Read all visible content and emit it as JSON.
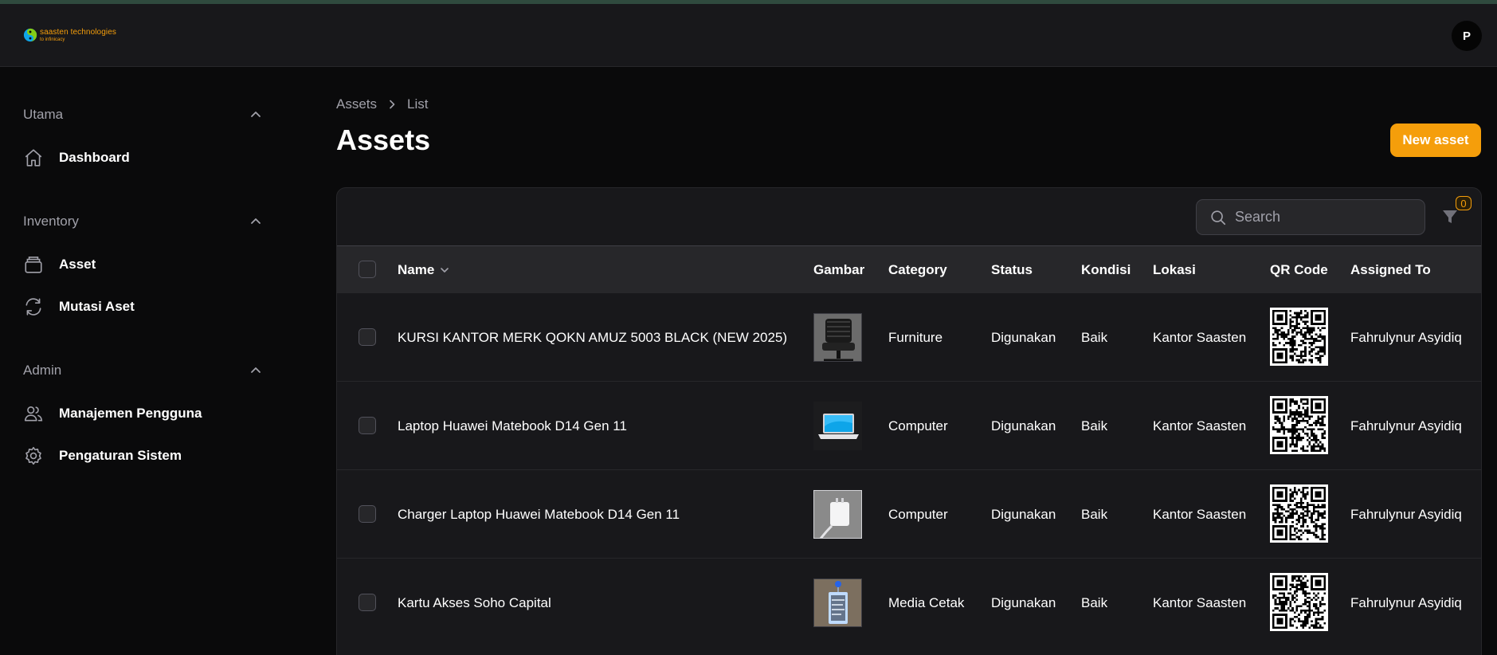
{
  "brand": {
    "line1": "saasten technologies",
    "line2": "to infinicacy"
  },
  "user": {
    "avatar_initial": "P"
  },
  "sidebar": {
    "groups": [
      {
        "label": "Utama",
        "items": [
          {
            "label": "Dashboard",
            "icon": "home-icon"
          }
        ]
      },
      {
        "label": "Inventory",
        "items": [
          {
            "label": "Asset",
            "icon": "box-icon"
          },
          {
            "label": "Mutasi Aset",
            "icon": "refresh-icon"
          }
        ]
      },
      {
        "label": "Admin",
        "items": [
          {
            "label": "Manajemen Pengguna",
            "icon": "users-icon"
          },
          {
            "label": "Pengaturan Sistem",
            "icon": "gear-icon"
          }
        ]
      }
    ]
  },
  "breadcrumb": {
    "first": "Assets",
    "second": "List"
  },
  "page": {
    "title": "Assets",
    "new_button": "New asset"
  },
  "table": {
    "search_placeholder": "Search",
    "filter_count": "0",
    "columns": {
      "name": "Name",
      "gambar": "Gambar",
      "category": "Category",
      "status": "Status",
      "kondisi": "Kondisi",
      "lokasi": "Lokasi",
      "qr": "QR Code",
      "assigned": "Assigned To"
    },
    "rows": [
      {
        "name": "KURSI KANTOR MERK QOKN AMUZ 5003 BLACK (NEW 2025)",
        "category": "Furniture",
        "status": "Digunakan",
        "kondisi": "Baik",
        "lokasi": "Kantor Saasten",
        "assigned": "Fahrulynur Asyidiq"
      },
      {
        "name": "Laptop Huawei Matebook D14 Gen 11",
        "category": "Computer",
        "status": "Digunakan",
        "kondisi": "Baik",
        "lokasi": "Kantor Saasten",
        "assigned": "Fahrulynur Asyidiq"
      },
      {
        "name": "Charger Laptop Huawei Matebook D14 Gen 11",
        "category": "Computer",
        "status": "Digunakan",
        "kondisi": "Baik",
        "lokasi": "Kantor Saasten",
        "assigned": "Fahrulynur Asyidiq"
      },
      {
        "name": "Kartu Akses Soho Capital",
        "category": "Media Cetak",
        "status": "Digunakan",
        "kondisi": "Baik",
        "lokasi": "Kantor Saasten",
        "assigned": "Fahrulynur Asyidiq"
      }
    ]
  },
  "colors": {
    "accent": "#f59e0b",
    "background": "#0a0a0b",
    "panel": "#18181b",
    "header_row": "#27272a"
  }
}
